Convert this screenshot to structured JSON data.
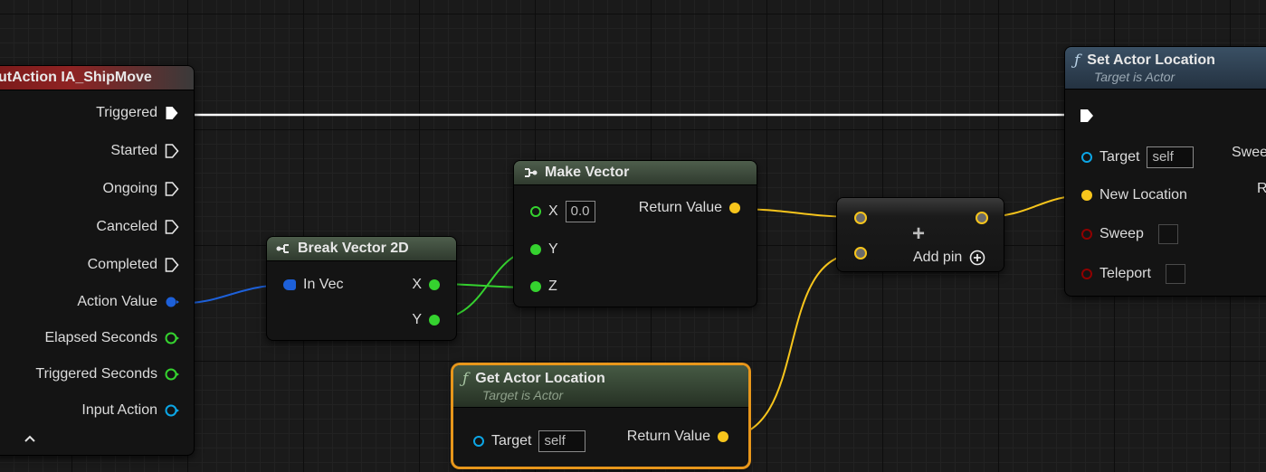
{
  "colors": {
    "exec": "#ffffff",
    "struct_blue": "#1d60d9",
    "float_green": "#35d22f",
    "vector_yellow": "#f7c51c",
    "object_blue": "#0ca6e6",
    "bool_red": "#8f0000",
    "select_orange": "#e7961b"
  },
  "input_action": {
    "title": "utAction IA_ShipMove",
    "pins": [
      {
        "label": "Triggered",
        "type": "exec"
      },
      {
        "label": "Started",
        "type": "exec"
      },
      {
        "label": "Ongoing",
        "type": "exec"
      },
      {
        "label": "Canceled",
        "type": "exec"
      },
      {
        "label": "Completed",
        "type": "exec"
      },
      {
        "label": "Action Value",
        "type": "struct"
      },
      {
        "label": "Elapsed Seconds",
        "type": "float"
      },
      {
        "label": "Triggered Seconds",
        "type": "float"
      },
      {
        "label": "Input Action",
        "type": "object"
      }
    ],
    "collapse_icon": "chevron-up-icon"
  },
  "break_vector": {
    "title": "Break Vector 2D",
    "icon": "break-struct-icon",
    "in_label": "In Vec",
    "out_x": "X",
    "out_y": "Y"
  },
  "make_vector": {
    "title": "Make Vector",
    "icon": "make-struct-icon",
    "x_label": "X",
    "x_value": "0.0",
    "y_label": "Y",
    "z_label": "Z",
    "return_label": "Return Value"
  },
  "add_node": {
    "plus": "+",
    "add_pin_label": "Add pin",
    "add_pin_icon": "circle-plus-icon"
  },
  "get_actor_location": {
    "title": "Get Actor Location",
    "subtitle": "Target is Actor",
    "func_icon": "ƒ",
    "target_label": "Target",
    "target_value": "self",
    "return_label": "Return Value"
  },
  "set_actor_location": {
    "title": "Set Actor Location",
    "subtitle": "Target is Actor",
    "func_icon": "ƒ",
    "target_label": "Target",
    "target_value": "self",
    "new_location_label": "New Location",
    "sweep_label": "Sweep",
    "teleport_label": "Teleport",
    "right_cut_1": "Swee",
    "right_cut_2": "R"
  }
}
